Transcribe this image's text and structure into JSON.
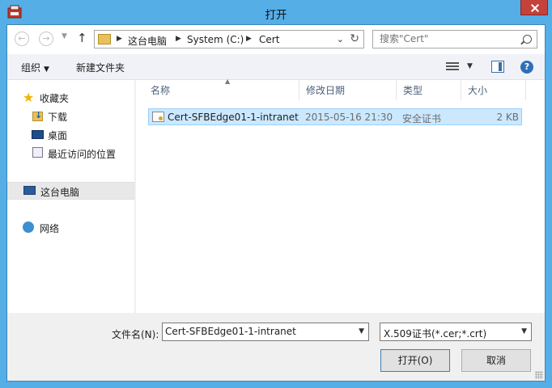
{
  "window": {
    "title": "打开"
  },
  "address": {
    "crumbs": [
      "这台电脑",
      "System (C:)",
      "Cert"
    ]
  },
  "search": {
    "placeholder": "搜索\"Cert\""
  },
  "toolbar": {
    "organize": "组织",
    "new_folder": "新建文件夹"
  },
  "sidebar": {
    "favorites": "收藏夹",
    "downloads": "下载",
    "desktop": "桌面",
    "recent": "最近访问的位置",
    "this_pc": "这台电脑",
    "network": "网络"
  },
  "columns": {
    "name": "名称",
    "modified": "修改日期",
    "type": "类型",
    "size": "大小"
  },
  "files": [
    {
      "name": "Cert-SFBEdge01-1-intranet",
      "modified": "2015-05-16 21:30",
      "type": "安全证书",
      "size": "2 KB"
    }
  ],
  "footer": {
    "filename_label": "文件名(N):",
    "filename_value": "Cert-SFBEdge01-1-intranet",
    "filetype": "X.509证书(*.cer;*.crt)",
    "open_button": "打开(O)",
    "cancel_button": "取消"
  }
}
